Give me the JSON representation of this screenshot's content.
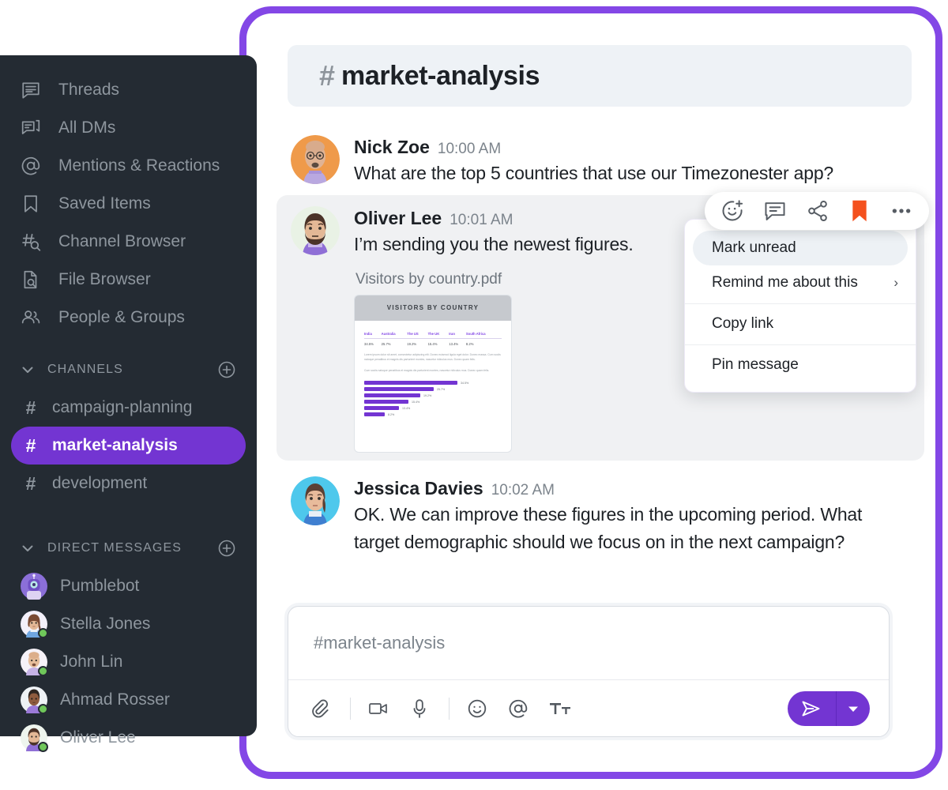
{
  "sidebar": {
    "nav_items": [
      {
        "label": "Threads",
        "icon": "threads-icon"
      },
      {
        "label": "All DMs",
        "icon": "all-dms-icon"
      },
      {
        "label": "Mentions & Reactions",
        "icon": "at-mention-icon"
      },
      {
        "label": "Saved Items",
        "icon": "bookmark-icon"
      },
      {
        "label": "Channel Browser",
        "icon": "channel-browser-icon"
      },
      {
        "label": "File Browser",
        "icon": "file-browser-icon"
      },
      {
        "label": "People & Groups",
        "icon": "people-groups-icon"
      }
    ],
    "channels_section": {
      "title": "CHANNELS",
      "items": [
        {
          "name": "campaign-planning",
          "active": false
        },
        {
          "name": "market-analysis",
          "active": true
        },
        {
          "name": "development",
          "active": false
        }
      ]
    },
    "dm_section": {
      "title": "DIRECT MESSAGES",
      "items": [
        {
          "name": "Pumblebot",
          "online": false
        },
        {
          "name": "Stella Jones",
          "online": true
        },
        {
          "name": "John Lin",
          "online": true
        },
        {
          "name": "Ahmad Rosser",
          "online": true
        },
        {
          "name": "Oliver Lee",
          "online": true
        }
      ]
    }
  },
  "header": {
    "hash": "#",
    "channel_name": "market-analysis"
  },
  "messages": [
    {
      "author": "Nick Zoe",
      "time": "10:00 AM",
      "text": "What are the top 5 countries that use our Timezonester app?",
      "highlighted": false
    },
    {
      "author": "Oliver Lee",
      "time": "10:01 AM",
      "text": " I’m sending you the newest figures.",
      "highlighted": true,
      "attachment": {
        "file_name": "Visitors by country.pdf",
        "preview_title": "VISITORS BY COUNTRY",
        "paragraph_1": "Lorem ipsum dolor sit amet, consectetur adipiscing elit. Donec euismod ligula eget dolor. Donec massa. Cum sociis natoque penatibus et magnis dis parturient montes, nascetur ridiculus mus. Donec quam felis.",
        "paragraph_2": "Cum sociis natoque penatibus et magnis dis parturient montes, nascetur ridiculus mus. Donec quam felis."
      }
    },
    {
      "author": "Jessica Davies",
      "time": "10:02 AM",
      "text": "OK. We can improve these figures in the upcoming period. What target demographic should we focus on in the next campaign?",
      "highlighted": false
    }
  ],
  "chart_data": {
    "type": "bar",
    "title": "VISITORS BY COUNTRY",
    "categories": [
      "India",
      "Australia",
      "The US",
      "The UK",
      "Iran",
      "South Africa"
    ],
    "values": [
      34.5,
      25.7,
      19.2,
      15.4,
      13.4,
      8.2
    ],
    "value_labels": [
      "34.5%",
      "25.7%",
      "19.2%",
      "15.4%",
      "13.4%",
      "8.2%"
    ],
    "xlabel": "",
    "ylabel": "",
    "ylim": [
      0,
      35
    ],
    "grid": false,
    "legend": "none",
    "orientation": "horizontal",
    "bar_color": "#7335d2"
  },
  "action_toolbar": {
    "actions": [
      {
        "name": "add-reaction",
        "icon": "emoji-plus-icon"
      },
      {
        "name": "reply-in-thread",
        "icon": "comment-icon"
      },
      {
        "name": "share-message",
        "icon": "share-icon"
      },
      {
        "name": "save-message",
        "icon": "bookmark-filled-icon"
      },
      {
        "name": "more-actions",
        "icon": "more-horizontal-icon"
      }
    ],
    "save_color": "#f4511e"
  },
  "context_menu": {
    "items": [
      {
        "label": "Mark unread",
        "active": true,
        "chevron": ""
      },
      {
        "label": "Remind me about this",
        "active": false,
        "chevron": "›"
      },
      {
        "label": "Copy link",
        "active": false,
        "chevron": ""
      },
      {
        "label": "Pin message",
        "active": false,
        "chevron": ""
      }
    ]
  },
  "composer": {
    "placeholder": "#market-analysis",
    "value": "",
    "tools": [
      {
        "name": "attach-file",
        "icon": "paperclip-icon"
      },
      {
        "name": "record-video",
        "icon": "video-camera-icon"
      },
      {
        "name": "record-audio",
        "icon": "microphone-icon"
      },
      {
        "name": "insert-emoji",
        "icon": "emoji-icon"
      },
      {
        "name": "mention-user",
        "icon": "at-icon"
      },
      {
        "name": "format-text",
        "icon": "text-format-icon"
      }
    ],
    "send_label": "send-icon",
    "send_caret": "▾"
  },
  "theme": {
    "accent_purple": "#7335d2",
    "frame_purple": "#8347e6",
    "sidebar_bg": "#242b33",
    "header_bg": "#eef2f6",
    "highlight_bg": "#f0f1f3",
    "online_green": "#6fc75a",
    "bookmark_orange": "#f4511e"
  }
}
